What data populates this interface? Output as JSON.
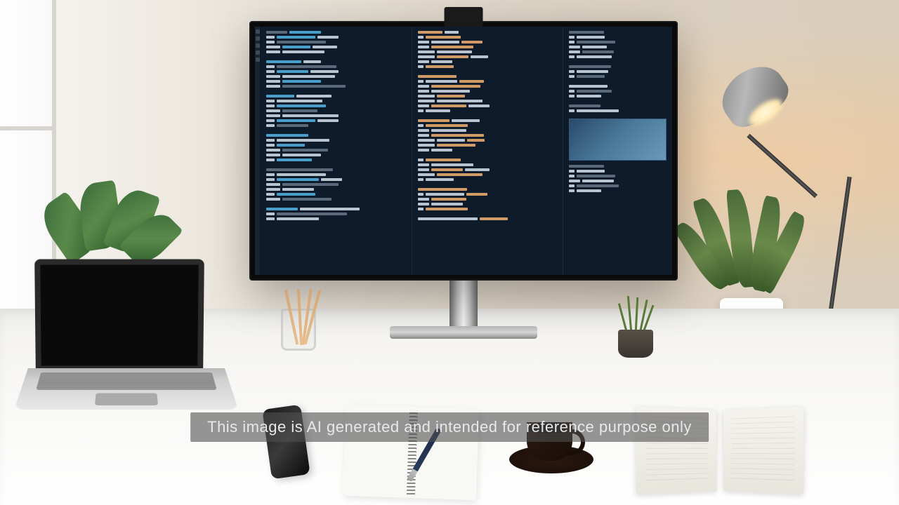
{
  "watermark": {
    "text": "This image is AI generated and intended for reference purpose only"
  }
}
